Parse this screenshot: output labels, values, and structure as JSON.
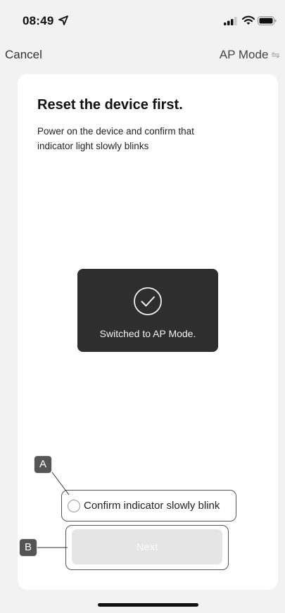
{
  "status_bar": {
    "time": "08:49",
    "location_icon": "location-arrow-icon",
    "signal_icon": "cellular-signal-icon",
    "wifi_icon": "wifi-icon",
    "battery_icon": "battery-icon"
  },
  "nav": {
    "cancel_label": "Cancel",
    "ap_mode_label": "AP Mode",
    "swap_icon": "⇋"
  },
  "content": {
    "title": "Reset the device first.",
    "description": "Power on the device and confirm that indicator light slowly blinks"
  },
  "toast": {
    "icon": "checkmark-circle-icon",
    "message": "Switched to AP Mode."
  },
  "confirm": {
    "label": "Confirm indicator slowly blink",
    "checked": false
  },
  "next": {
    "label": "Next",
    "enabled": false
  },
  "annotations": {
    "a": "A",
    "b": "B"
  },
  "colors": {
    "background": "#f2f2f2",
    "card": "#ffffff",
    "toast": "#2e2e2e",
    "button_disabled": "#e5e5e5"
  }
}
